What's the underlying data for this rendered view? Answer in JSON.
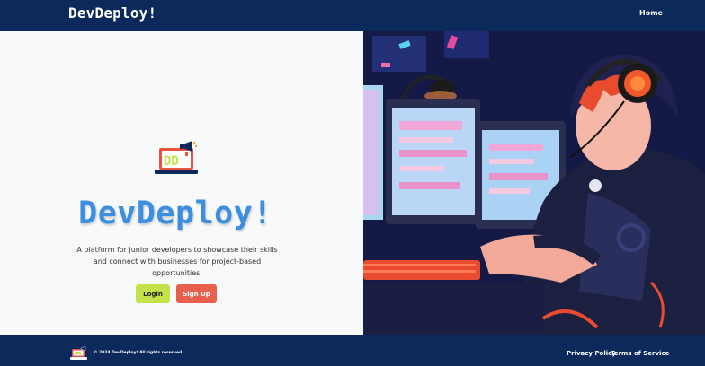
{
  "navbar": {
    "brand": "DevDeploy!",
    "home_label": "Home"
  },
  "hero": {
    "title": "DevDeploy!",
    "description": "A platform for junior developers to showcase their skills and connect with businesses for project-based opportunities.",
    "login_label": "Login",
    "signup_label": "Sign Up",
    "logo_text": "DD"
  },
  "footer": {
    "copyright": "© 2024 DevDeploy! All rights reserved.",
    "links": [
      {
        "label": "Privacy Policy"
      },
      {
        "label": "Terms of Service"
      }
    ]
  },
  "colors": {
    "nav_bg": "#0b2a5b",
    "title_blue": "#3b8ee0",
    "login_green": "#c6e24a",
    "signup_red": "#e8604c"
  }
}
